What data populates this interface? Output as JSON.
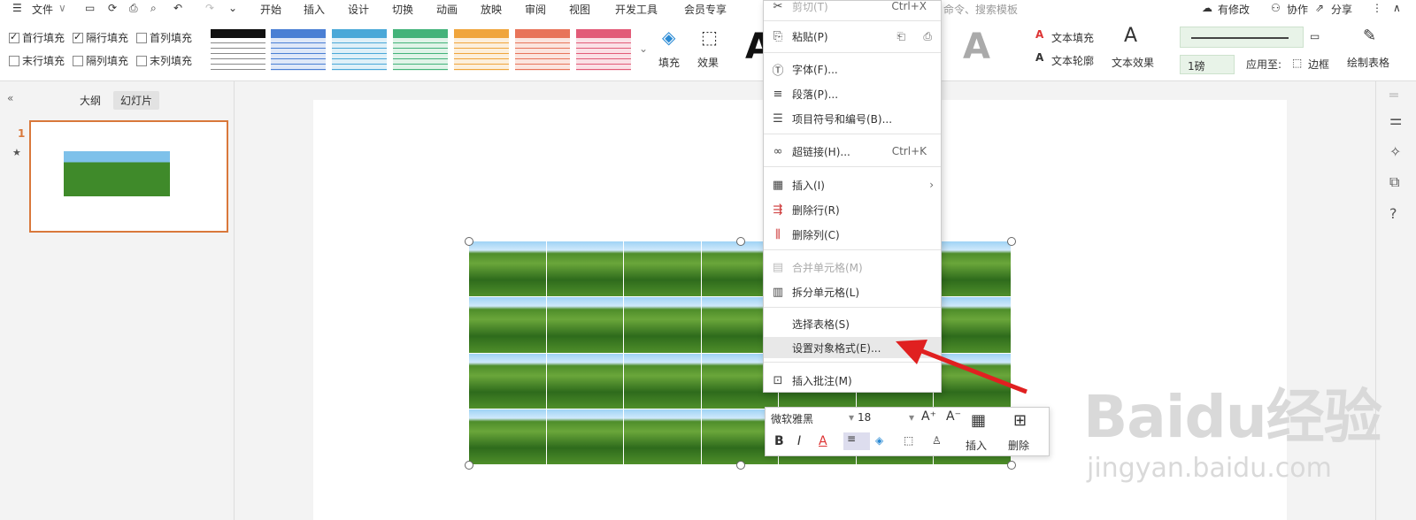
{
  "menubar": {
    "file": "文件",
    "tabs": [
      "开始",
      "插入",
      "设计",
      "切换",
      "动画",
      "放映",
      "审阅",
      "视图",
      "开发工具",
      "会员专享"
    ],
    "search_hint": "命令、搜索模板",
    "right": {
      "unsaved": "有修改",
      "collab": "协作",
      "share": "分享"
    }
  },
  "ribbon": {
    "checks": [
      {
        "label": "首行填充",
        "checked": true
      },
      {
        "label": "隔行填充",
        "checked": true
      },
      {
        "label": "首列填充",
        "checked": false
      },
      {
        "label": "末行填充",
        "checked": false
      },
      {
        "label": "隔列填充",
        "checked": false
      },
      {
        "label": "末列填充",
        "checked": false
      }
    ],
    "style_colors": [
      "#111111",
      "#4a7fd4",
      "#4aa8d8",
      "#43b37a",
      "#f0a53c",
      "#e8745a",
      "#e25b78"
    ],
    "fill": "填充",
    "effect": "效果",
    "text_fill": "文本填充",
    "text_outline": "文本轮廓",
    "text_effect": "文本效果",
    "line_weight": "1磅",
    "apply_to": "应用至:",
    "border": "边框",
    "draw_table": "绘制表格"
  },
  "left_panel": {
    "tab_outline": "大纲",
    "tab_slides": "幻灯片",
    "slide_number": "1"
  },
  "context_menu": {
    "items": [
      {
        "label": "剪切(T)",
        "shortcut": "Ctrl+X",
        "icon": "scissors-icon",
        "glyph": "✂",
        "disabled": true
      },
      {
        "label": "粘贴(P)",
        "shortcut": "",
        "icon": "paste-icon",
        "glyph": "📋",
        "disabled": false
      },
      {
        "label": "字体(F)...",
        "shortcut": "",
        "icon": "font-icon",
        "glyph": "Ⓣ",
        "disabled": false
      },
      {
        "label": "段落(P)...",
        "shortcut": "",
        "icon": "paragraph-icon",
        "glyph": "≡",
        "disabled": false
      },
      {
        "label": "项目符号和编号(B)...",
        "shortcut": "",
        "icon": "bullets-icon",
        "glyph": "☰",
        "disabled": false
      },
      {
        "label": "超链接(H)...",
        "shortcut": "Ctrl+K",
        "icon": "link-icon",
        "glyph": "🔗",
        "disabled": false
      },
      {
        "label": "插入(I)",
        "shortcut": "›",
        "icon": "insert-table-icon",
        "glyph": "▦",
        "disabled": false
      },
      {
        "label": "删除行(R)",
        "shortcut": "",
        "icon": "delete-row-icon",
        "glyph": "⇶",
        "disabled": false
      },
      {
        "label": "删除列(C)",
        "shortcut": "",
        "icon": "delete-column-icon",
        "glyph": "⫼",
        "disabled": false
      },
      {
        "label": "合并单元格(M)",
        "shortcut": "",
        "icon": "merge-cells-icon",
        "glyph": "▤",
        "disabled": true
      },
      {
        "label": "拆分单元格(L)",
        "shortcut": "",
        "icon": "split-cells-icon",
        "glyph": "▥",
        "disabled": false
      },
      {
        "label": "选择表格(S)",
        "shortcut": "",
        "icon": "",
        "glyph": "",
        "disabled": false
      },
      {
        "label": "设置对象格式(E)...",
        "shortcut": "",
        "icon": "",
        "glyph": "",
        "disabled": false,
        "highlighted": true
      },
      {
        "label": "插入批注(M)",
        "shortcut": "",
        "icon": "comment-icon",
        "glyph": "🗨",
        "disabled": false
      }
    ]
  },
  "mini_toolbar": {
    "font": "微软雅黑",
    "size": "18",
    "insert": "插入",
    "delete": "删除"
  },
  "watermark": {
    "brand": "Baidu经验",
    "url": "jingyan.baidu.com"
  },
  "colors": {
    "accent_thumb_border": "#d9783b",
    "arrow": "#e02020"
  }
}
